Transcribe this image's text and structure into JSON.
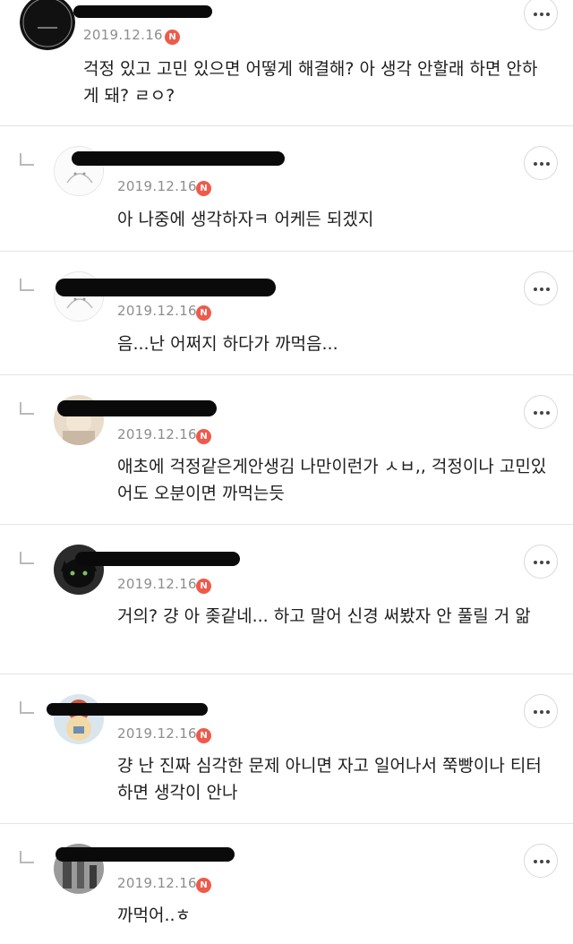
{
  "comments": [
    {
      "date": "2019.12.16",
      "badge": "N",
      "text": "걱정 있고 고민 있으면 어떻게 해결해? 아 생각 안할래 하면 안하게 돼? ㄹㅇ?"
    },
    {
      "date": "2019.12.16",
      "badge": "N",
      "text": "아 나중에 생각하자ㅋ 어케든 되겠지"
    },
    {
      "date": "2019.12.16",
      "badge": "N",
      "text": "음...난 어쩌지 하다가  까먹음..."
    },
    {
      "date": "2019.12.16",
      "badge": "N",
      "text": "애초에 걱정같은게안생김 나만이런가 ㅅㅂ,, 걱정이나 고민있어도 오분이면 까먹는듯"
    },
    {
      "date": "2019.12.16",
      "badge": "N",
      "text": "거의? 걍 아 좆같네... 하고 말어 신경 써봤자 안 풀릴 거 앎"
    },
    {
      "date": "2019.12.16",
      "badge": "N",
      "text": "걍 난 진짜 심각한 문제 아니면 자고 일어나서 쭉빵이나 티터 하면 생각이 안나"
    },
    {
      "date": "2019.12.16",
      "badge": "N",
      "text": "까먹어..ㅎ"
    }
  ]
}
